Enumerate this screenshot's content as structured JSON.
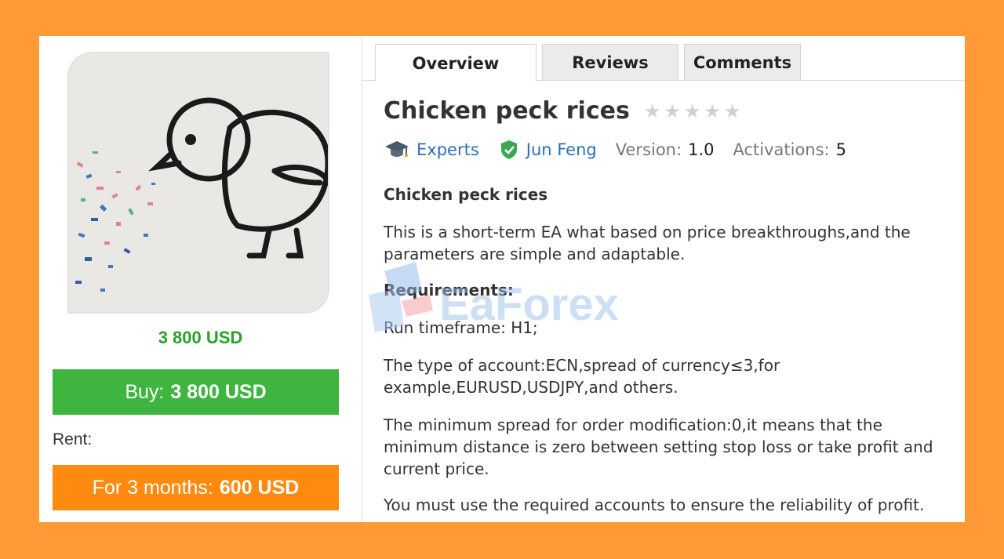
{
  "left": {
    "price": "3 800 USD",
    "buy_prefix": "Buy:",
    "buy_price": "3 800 USD",
    "rent_label": "Rent:",
    "rent_prefix": "For 3 months:",
    "rent_price": "600 USD"
  },
  "tabs": [
    "Overview",
    "Reviews",
    "Comments"
  ],
  "product": {
    "title": "Chicken peck rices",
    "rating": 0,
    "category": "Experts",
    "author": "Jun Feng",
    "version_label": "Version:",
    "version": "1.0",
    "activations_label": "Activations:",
    "activations": "5"
  },
  "description": {
    "heading": "Chicken peck rices",
    "intro": "This is a short-term EA what based on price breakthroughs,and the parameters are simple and adaptable.",
    "requirements_heading": "Requirements:",
    "items": [
      "Run timeframe: H1;",
      "The type of account:ECN,spread of currency≤3,for example,EURUSD,USDJPY,and others.",
      "The minimum spread for order modification:0,it means that the minimum distance is zero between setting stop loss or take profit and current price.",
      "You must use the required accounts to ensure the reliability of profit."
    ]
  },
  "watermark": "EaForex",
  "colors": {
    "background": "#ff9a36",
    "buy": "#3fb53f",
    "rent": "#ff8a10",
    "price": "#27a327",
    "link": "#2d6fb6"
  }
}
